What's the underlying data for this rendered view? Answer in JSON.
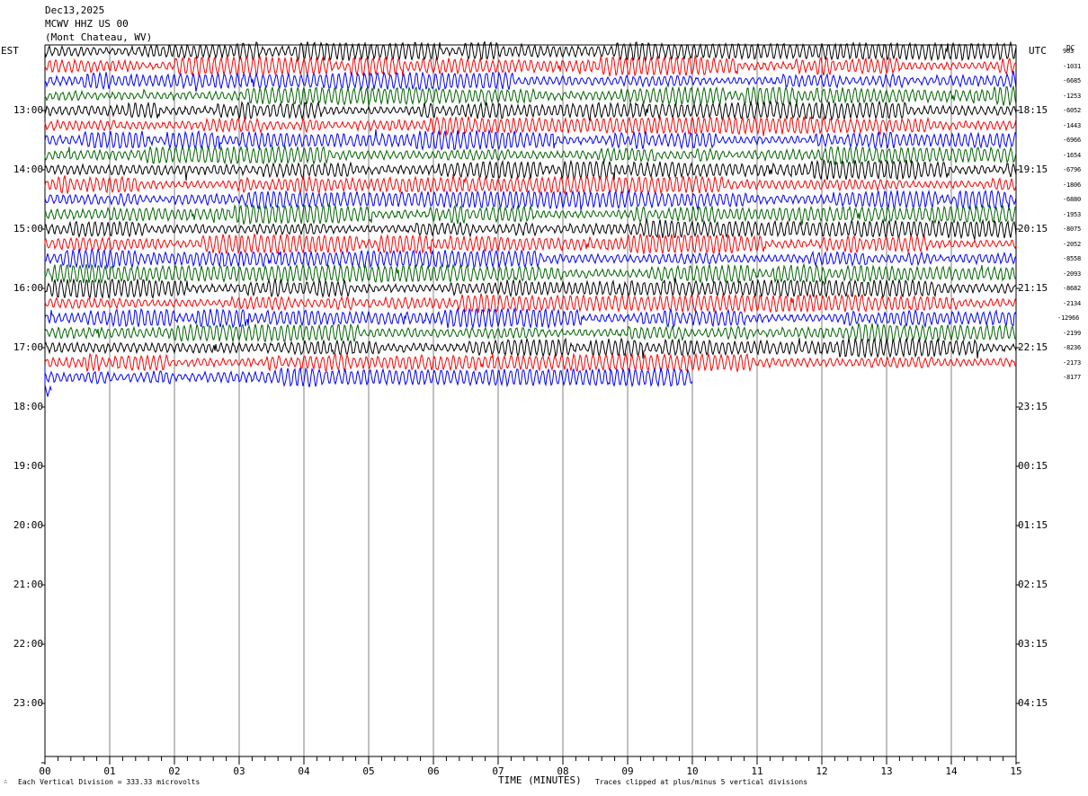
{
  "header": {
    "date": "Dec13,2025",
    "station": "MCWV HHZ US 00",
    "location": "(Mont Chateau, WV)"
  },
  "left_timezone": "EST",
  "right_timezone": "UTC",
  "dc_label": "DC",
  "colors": {
    "black": "#000000",
    "red": "#ff0000",
    "blue": "#0000ff",
    "green": "#006400",
    "grid": "#808080"
  },
  "chart_data": {
    "type": "line",
    "title": "Dec13,2025 MCWV HHZ US 00 (Mont Chateau, WV)",
    "xlabel": "TIME (MINUTES)",
    "xlim": [
      0,
      15
    ],
    "x_ticks": [
      "00",
      "01",
      "02",
      "03",
      "04",
      "05",
      "06",
      "07",
      "08",
      "09",
      "10",
      "11",
      "12",
      "13",
      "14",
      "15"
    ],
    "left_hour_labels": [
      "13:00",
      "14:00",
      "15:00",
      "16:00",
      "17:00",
      "18:00",
      "19:00",
      "20:00",
      "21:00",
      "22:00",
      "23:00"
    ],
    "right_hour_labels": [
      "18:15",
      "19:15",
      "20:15",
      "21:15",
      "22:15",
      "23:15",
      "00:15",
      "01:15",
      "02:15",
      "03:15",
      "04:15"
    ],
    "dc_offsets": [
      "903",
      "-1031",
      "-6685",
      "-1253",
      "-6052",
      "-1443",
      "-6966",
      "-1654",
      "-6796",
      "-1806",
      "-6880",
      "-1953",
      "-8075",
      "-2052",
      "-8558",
      "-2093",
      "-8682",
      "-2134",
      "-12966",
      "-2199",
      "-8236",
      "-2173",
      "-8177"
    ],
    "trace_colors_cycle": [
      "black",
      "red",
      "blue",
      "green"
    ],
    "traces_count": 23,
    "last_trace_end_minute": 10,
    "partial_trace_end_minute": 0.1,
    "scale_note": "Each Vertical Division =  333.33 microvolts",
    "clip_note": "Traces clipped at plus/minus 5 vertical divisions",
    "grid": true
  }
}
